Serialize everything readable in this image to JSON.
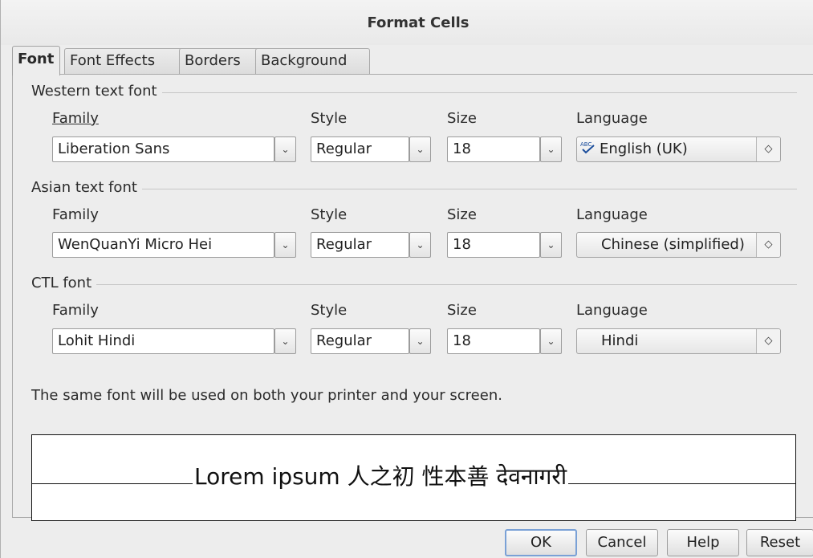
{
  "dialog": {
    "title": "Format Cells"
  },
  "tabs": [
    {
      "label": "Font",
      "active": true
    },
    {
      "label": "Font Effects"
    },
    {
      "label": "Borders"
    },
    {
      "label": "Background"
    }
  ],
  "labels": {
    "family": "Family",
    "style": "Style",
    "size": "Size",
    "language": "Language"
  },
  "western": {
    "title": "Western text font",
    "family": "Liberation Sans",
    "style": "Regular",
    "size": "18",
    "language": "English (UK)"
  },
  "asian": {
    "title": "Asian text font",
    "family": "WenQuanYi Micro Hei",
    "style": "Regular",
    "size": "18",
    "language": "Chinese (simplified)"
  },
  "ctl": {
    "title": "CTL font",
    "family": "Lohit Hindi",
    "style": "Regular",
    "size": "18",
    "language": "Hindi"
  },
  "note": "The same font will be used on both your printer and your screen.",
  "preview": {
    "text": "Lorem ipsum   人之初 性本善  देवनागरी"
  },
  "buttons": {
    "ok": "OK",
    "cancel": "Cancel",
    "help": "Help",
    "reset": "Reset"
  },
  "icons": {
    "dropdown": "chevron-down-icon",
    "spin": "spin-updown-icon",
    "spellcheck": "spellcheck-icon"
  },
  "colors": {
    "default_button_border": "#7aa1d6",
    "panel_bg": "#ededed"
  }
}
